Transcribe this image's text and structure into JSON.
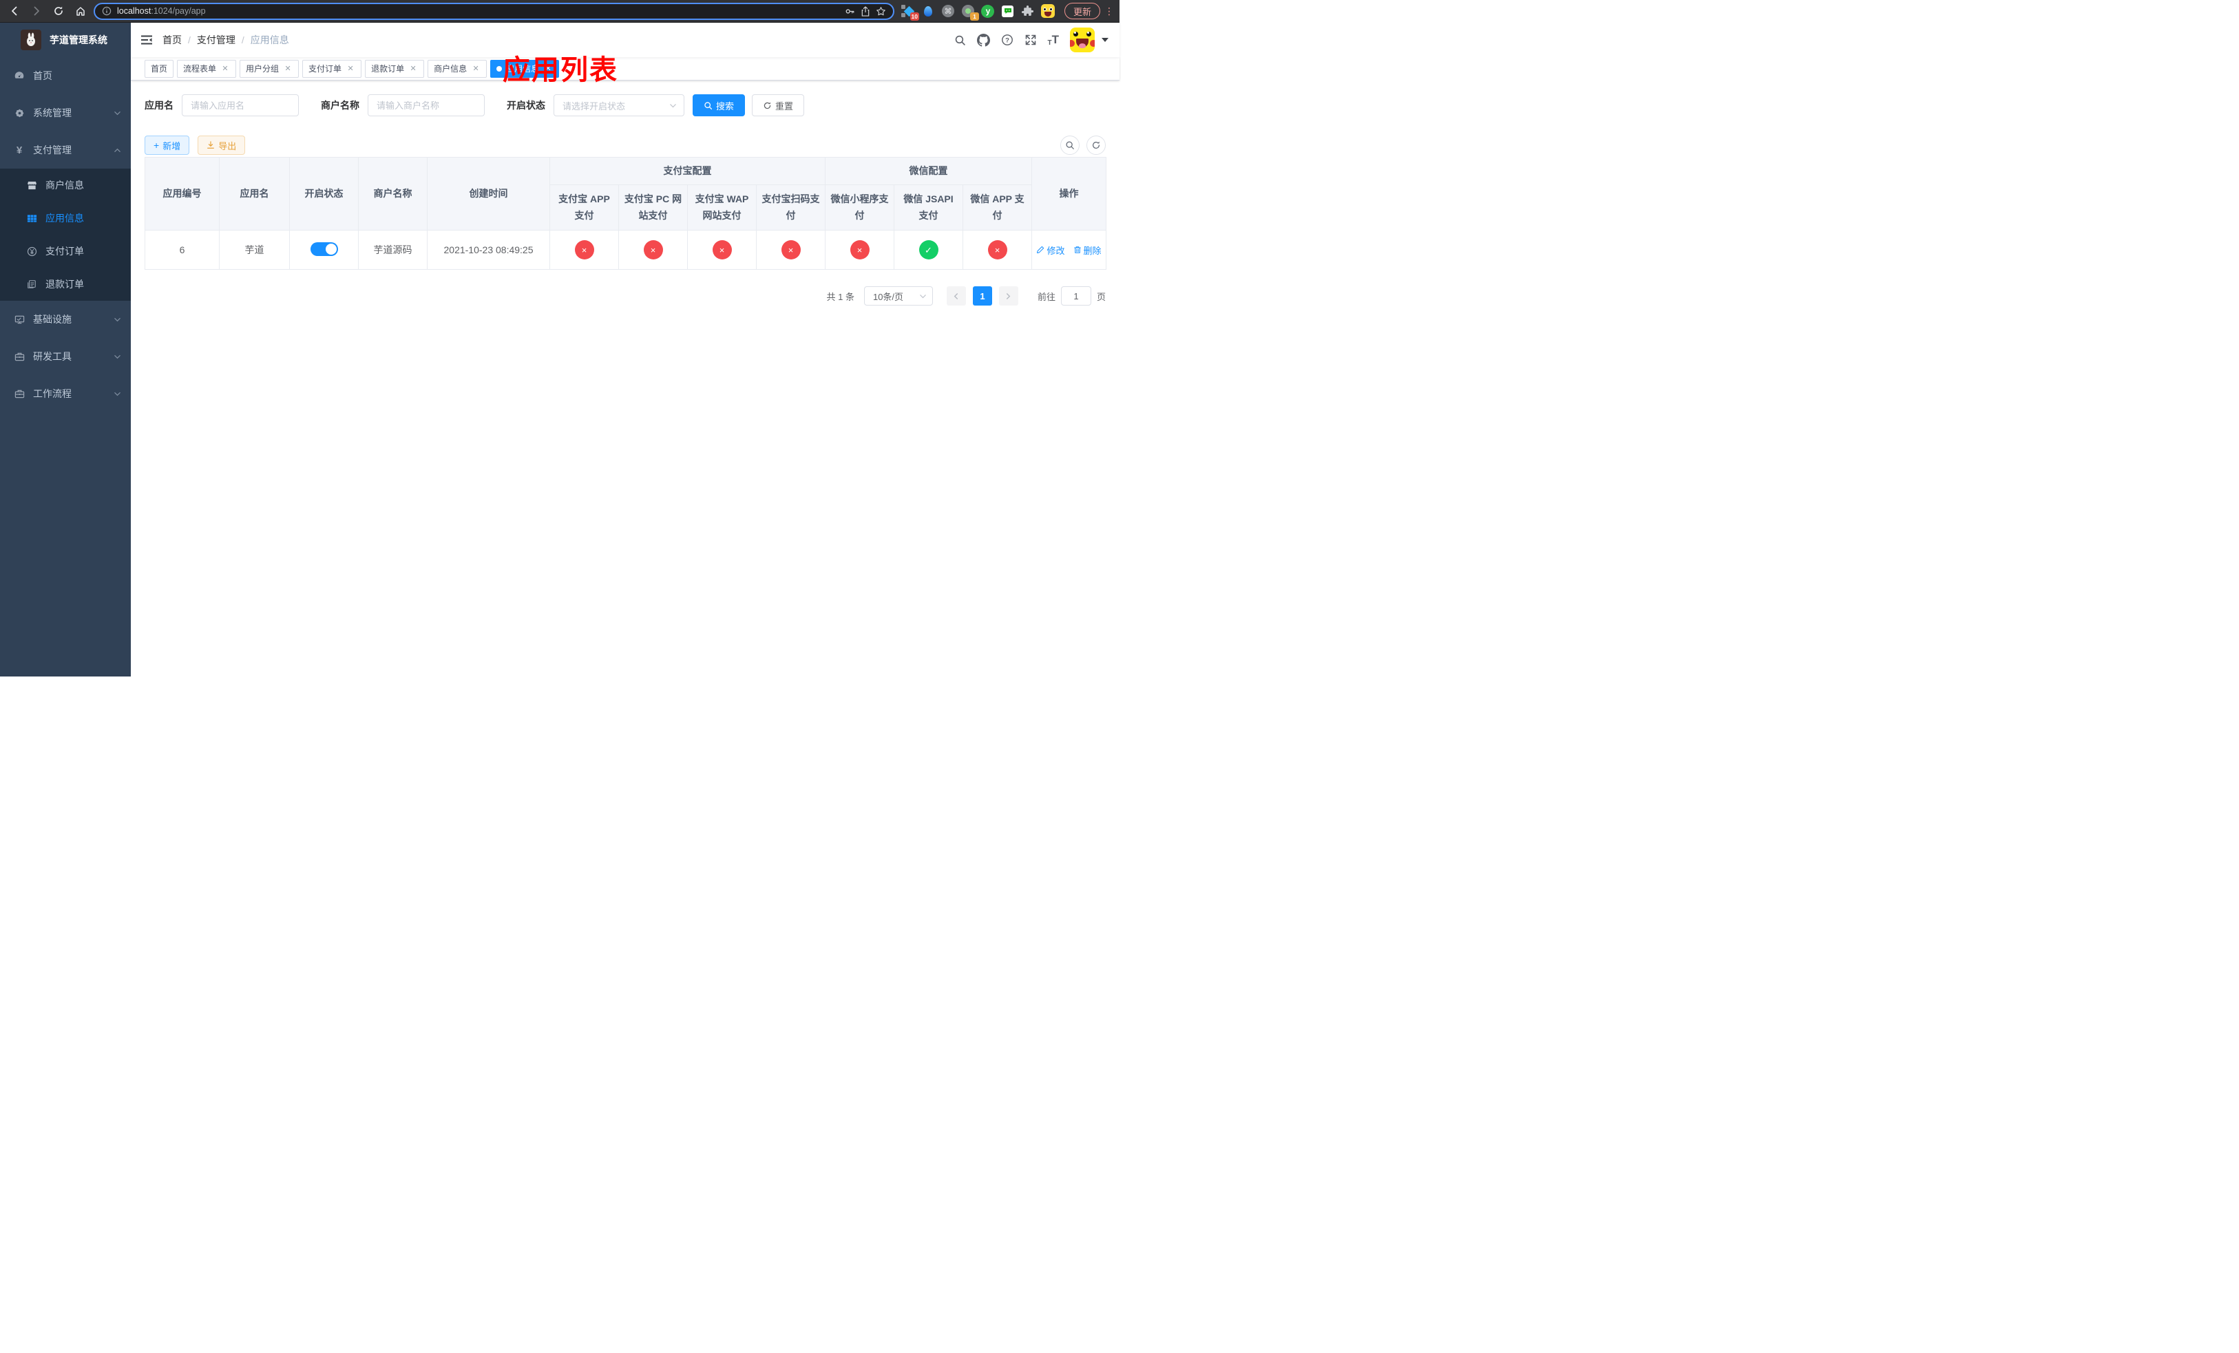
{
  "colors": {
    "accent": "#1890ff",
    "danger": "#f4494d",
    "success": "#13ce66",
    "warning": "#e6a23c",
    "sidebar_bg": "#304156",
    "submenu_bg": "#1f2d3d"
  },
  "browser": {
    "url_host": "localhost",
    "url_rest": ":1024/pay/app",
    "update_label": "更新",
    "ext_badge_a": "10",
    "ext_badge_b": "1",
    "ext_y_letter": "y"
  },
  "sidebar": {
    "title": "芋道管理系统",
    "menu": [
      {
        "label": "首页"
      },
      {
        "label": "系统管理"
      },
      {
        "label": "支付管理"
      }
    ],
    "submenu": [
      {
        "label": "商户信息"
      },
      {
        "label": "应用信息"
      },
      {
        "label": "支付订单"
      },
      {
        "label": "退款订单"
      }
    ],
    "menu_lower": [
      {
        "label": "基础设施"
      },
      {
        "label": "研发工具"
      },
      {
        "label": "工作流程"
      }
    ]
  },
  "navbar": {
    "breadcrumb": [
      {
        "label": "首页"
      },
      {
        "label": "支付管理"
      },
      {
        "label": "应用信息"
      }
    ]
  },
  "annotation": "应用列表",
  "tabs": [
    {
      "label": "首页"
    },
    {
      "label": "流程表单"
    },
    {
      "label": "用户分组"
    },
    {
      "label": "支付订单"
    },
    {
      "label": "退款订单"
    },
    {
      "label": "商户信息"
    },
    {
      "label": "应用信息"
    }
  ],
  "filters": {
    "app_name_label": "应用名",
    "app_name_placeholder": "请输入应用名",
    "merchant_label": "商户名称",
    "merchant_placeholder": "请输入商户名称",
    "status_label": "开启状态",
    "status_placeholder": "请选择开启状态",
    "search_label": "搜索",
    "reset_label": "重置"
  },
  "toolbar": {
    "add_label": "新增",
    "export_label": "导出"
  },
  "table": {
    "headers": {
      "app_id": "应用编号",
      "app_name": "应用名",
      "status": "开启状态",
      "merchant": "商户名称",
      "create_time": "创建时间",
      "alipay_group": "支付宝配置",
      "wechat_group": "微信配置",
      "alipay_app": "支付宝 APP 支付",
      "alipay_pc": "支付宝 PC 网站支付",
      "alipay_wap": "支付宝 WAP 网站支付",
      "alipay_qr": "支付宝扫码支付",
      "wechat_lite": "微信小程序支付",
      "wechat_jsapi": "微信 JSAPI 支付",
      "wechat_app": "微信 APP 支付",
      "actions": "操作"
    },
    "row": {
      "app_id": "6",
      "app_name": "芋道",
      "status_on": true,
      "merchant": "芋道源码",
      "create_time": "2021-10-23 08:49:25",
      "configs": [
        {
          "name": "alipay-app",
          "state": "off",
          "glyph": "×"
        },
        {
          "name": "alipay-pc",
          "state": "off",
          "glyph": "×"
        },
        {
          "name": "alipay-wap",
          "state": "off",
          "glyph": "×"
        },
        {
          "name": "alipay-qr",
          "state": "off",
          "glyph": "×"
        },
        {
          "name": "wechat-lite",
          "state": "off",
          "glyph": "×"
        },
        {
          "name": "wechat-jsapi",
          "state": "on",
          "glyph": "✓"
        },
        {
          "name": "wechat-app",
          "state": "off",
          "glyph": "×"
        }
      ],
      "edit_label": "修改",
      "delete_label": "删除"
    }
  },
  "pagination": {
    "total": "共 1 条",
    "page_size": "10条/页",
    "current": "1",
    "goto_label": "前往",
    "goto_value": "1",
    "page_suffix": "页"
  }
}
